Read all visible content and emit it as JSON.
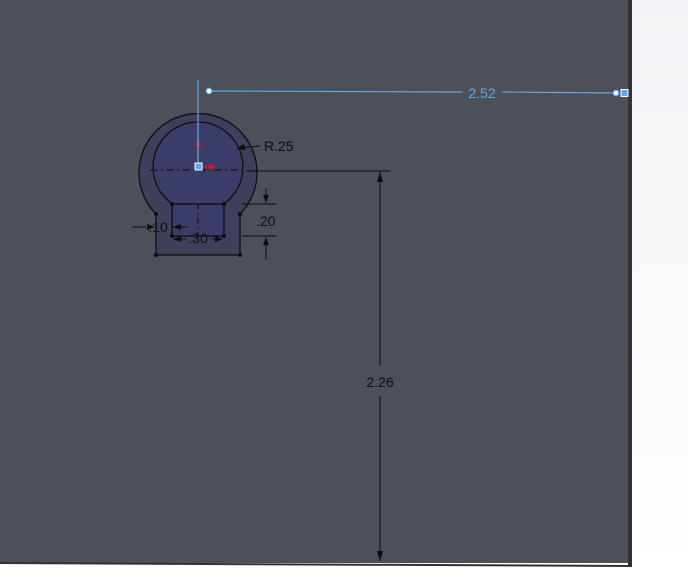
{
  "sketch": {
    "colors": {
      "face": "#4e5059",
      "face_edge": "#303238",
      "profile_fill": "#3e3f5b",
      "inner_fill": "#3b3c68",
      "line": "#0d0e12",
      "selected": "#5aa9ec",
      "origin": "#d61a1a",
      "background": "#f2f3f6"
    },
    "dimensions": {
      "horizontal_offset": "2.52",
      "vertical_offset": "2.26",
      "radius": "R.25",
      "slot_height": ".20",
      "slot_width": ".30",
      "wall": ".10"
    }
  }
}
